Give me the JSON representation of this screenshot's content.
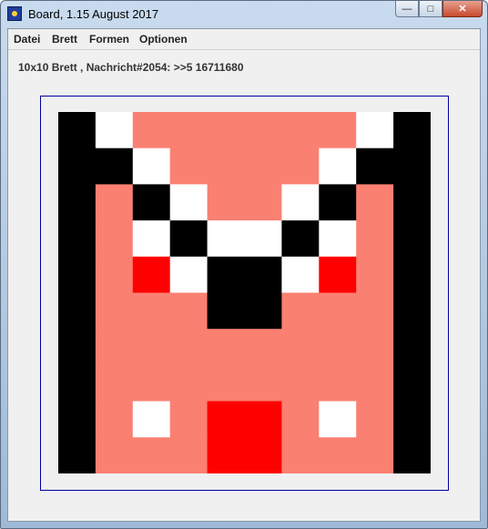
{
  "window": {
    "title": "Board, 1.15 August 2017"
  },
  "title_buttons": {
    "minimize": "—",
    "maximize": "□",
    "close": "✕"
  },
  "menu": {
    "items": [
      "Datei",
      "Brett",
      "Formen",
      "Optionen"
    ]
  },
  "status": {
    "text": "10x10 Brett , Nachricht#2054: >>5 16711680"
  },
  "board": {
    "rows": 10,
    "cols": 10,
    "palette": {
      "K": "#000000",
      "S": "#fa8072",
      "R": "#ff0000",
      "W": "#ffffff",
      "G": "#eeeeee"
    },
    "cells": [
      [
        "K",
        "W",
        "S",
        "S",
        "S",
        "S",
        "S",
        "S",
        "W",
        "K"
      ],
      [
        "K",
        "K",
        "W",
        "S",
        "S",
        "S",
        "S",
        "W",
        "K",
        "K"
      ],
      [
        "K",
        "S",
        "K",
        "W",
        "S",
        "S",
        "W",
        "K",
        "S",
        "K"
      ],
      [
        "K",
        "S",
        "W",
        "K",
        "W",
        "W",
        "K",
        "W",
        "S",
        "K"
      ],
      [
        "K",
        "S",
        "R",
        "W",
        "K",
        "K",
        "W",
        "R",
        "S",
        "K"
      ],
      [
        "K",
        "S",
        "S",
        "S",
        "K",
        "K",
        "S",
        "S",
        "S",
        "K"
      ],
      [
        "K",
        "S",
        "S",
        "S",
        "S",
        "S",
        "S",
        "S",
        "S",
        "K"
      ],
      [
        "K",
        "S",
        "S",
        "S",
        "S",
        "S",
        "S",
        "S",
        "S",
        "K"
      ],
      [
        "K",
        "S",
        "W",
        "S",
        "R",
        "R",
        "S",
        "W",
        "S",
        "K"
      ],
      [
        "K",
        "S",
        "S",
        "S",
        "R",
        "R",
        "S",
        "S",
        "S",
        "K"
      ]
    ]
  }
}
